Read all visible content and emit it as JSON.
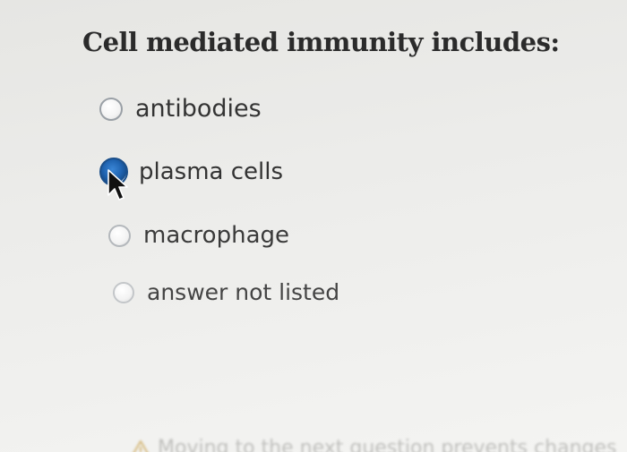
{
  "question": {
    "title": "Cell mediated immunity includes:"
  },
  "options": [
    {
      "label": "antibodies",
      "selected": false
    },
    {
      "label": "plasma cells",
      "selected": true
    },
    {
      "label": "macrophage",
      "selected": false
    },
    {
      "label": "answer not listed",
      "selected": false
    }
  ],
  "notice": {
    "text": "Moving to the next question prevents changes",
    "icon": "warning-icon"
  },
  "colors": {
    "selected_radio": "#1f63b0",
    "title_text": "#2b2b2b",
    "option_text": "#333333",
    "background": "#ececea"
  }
}
